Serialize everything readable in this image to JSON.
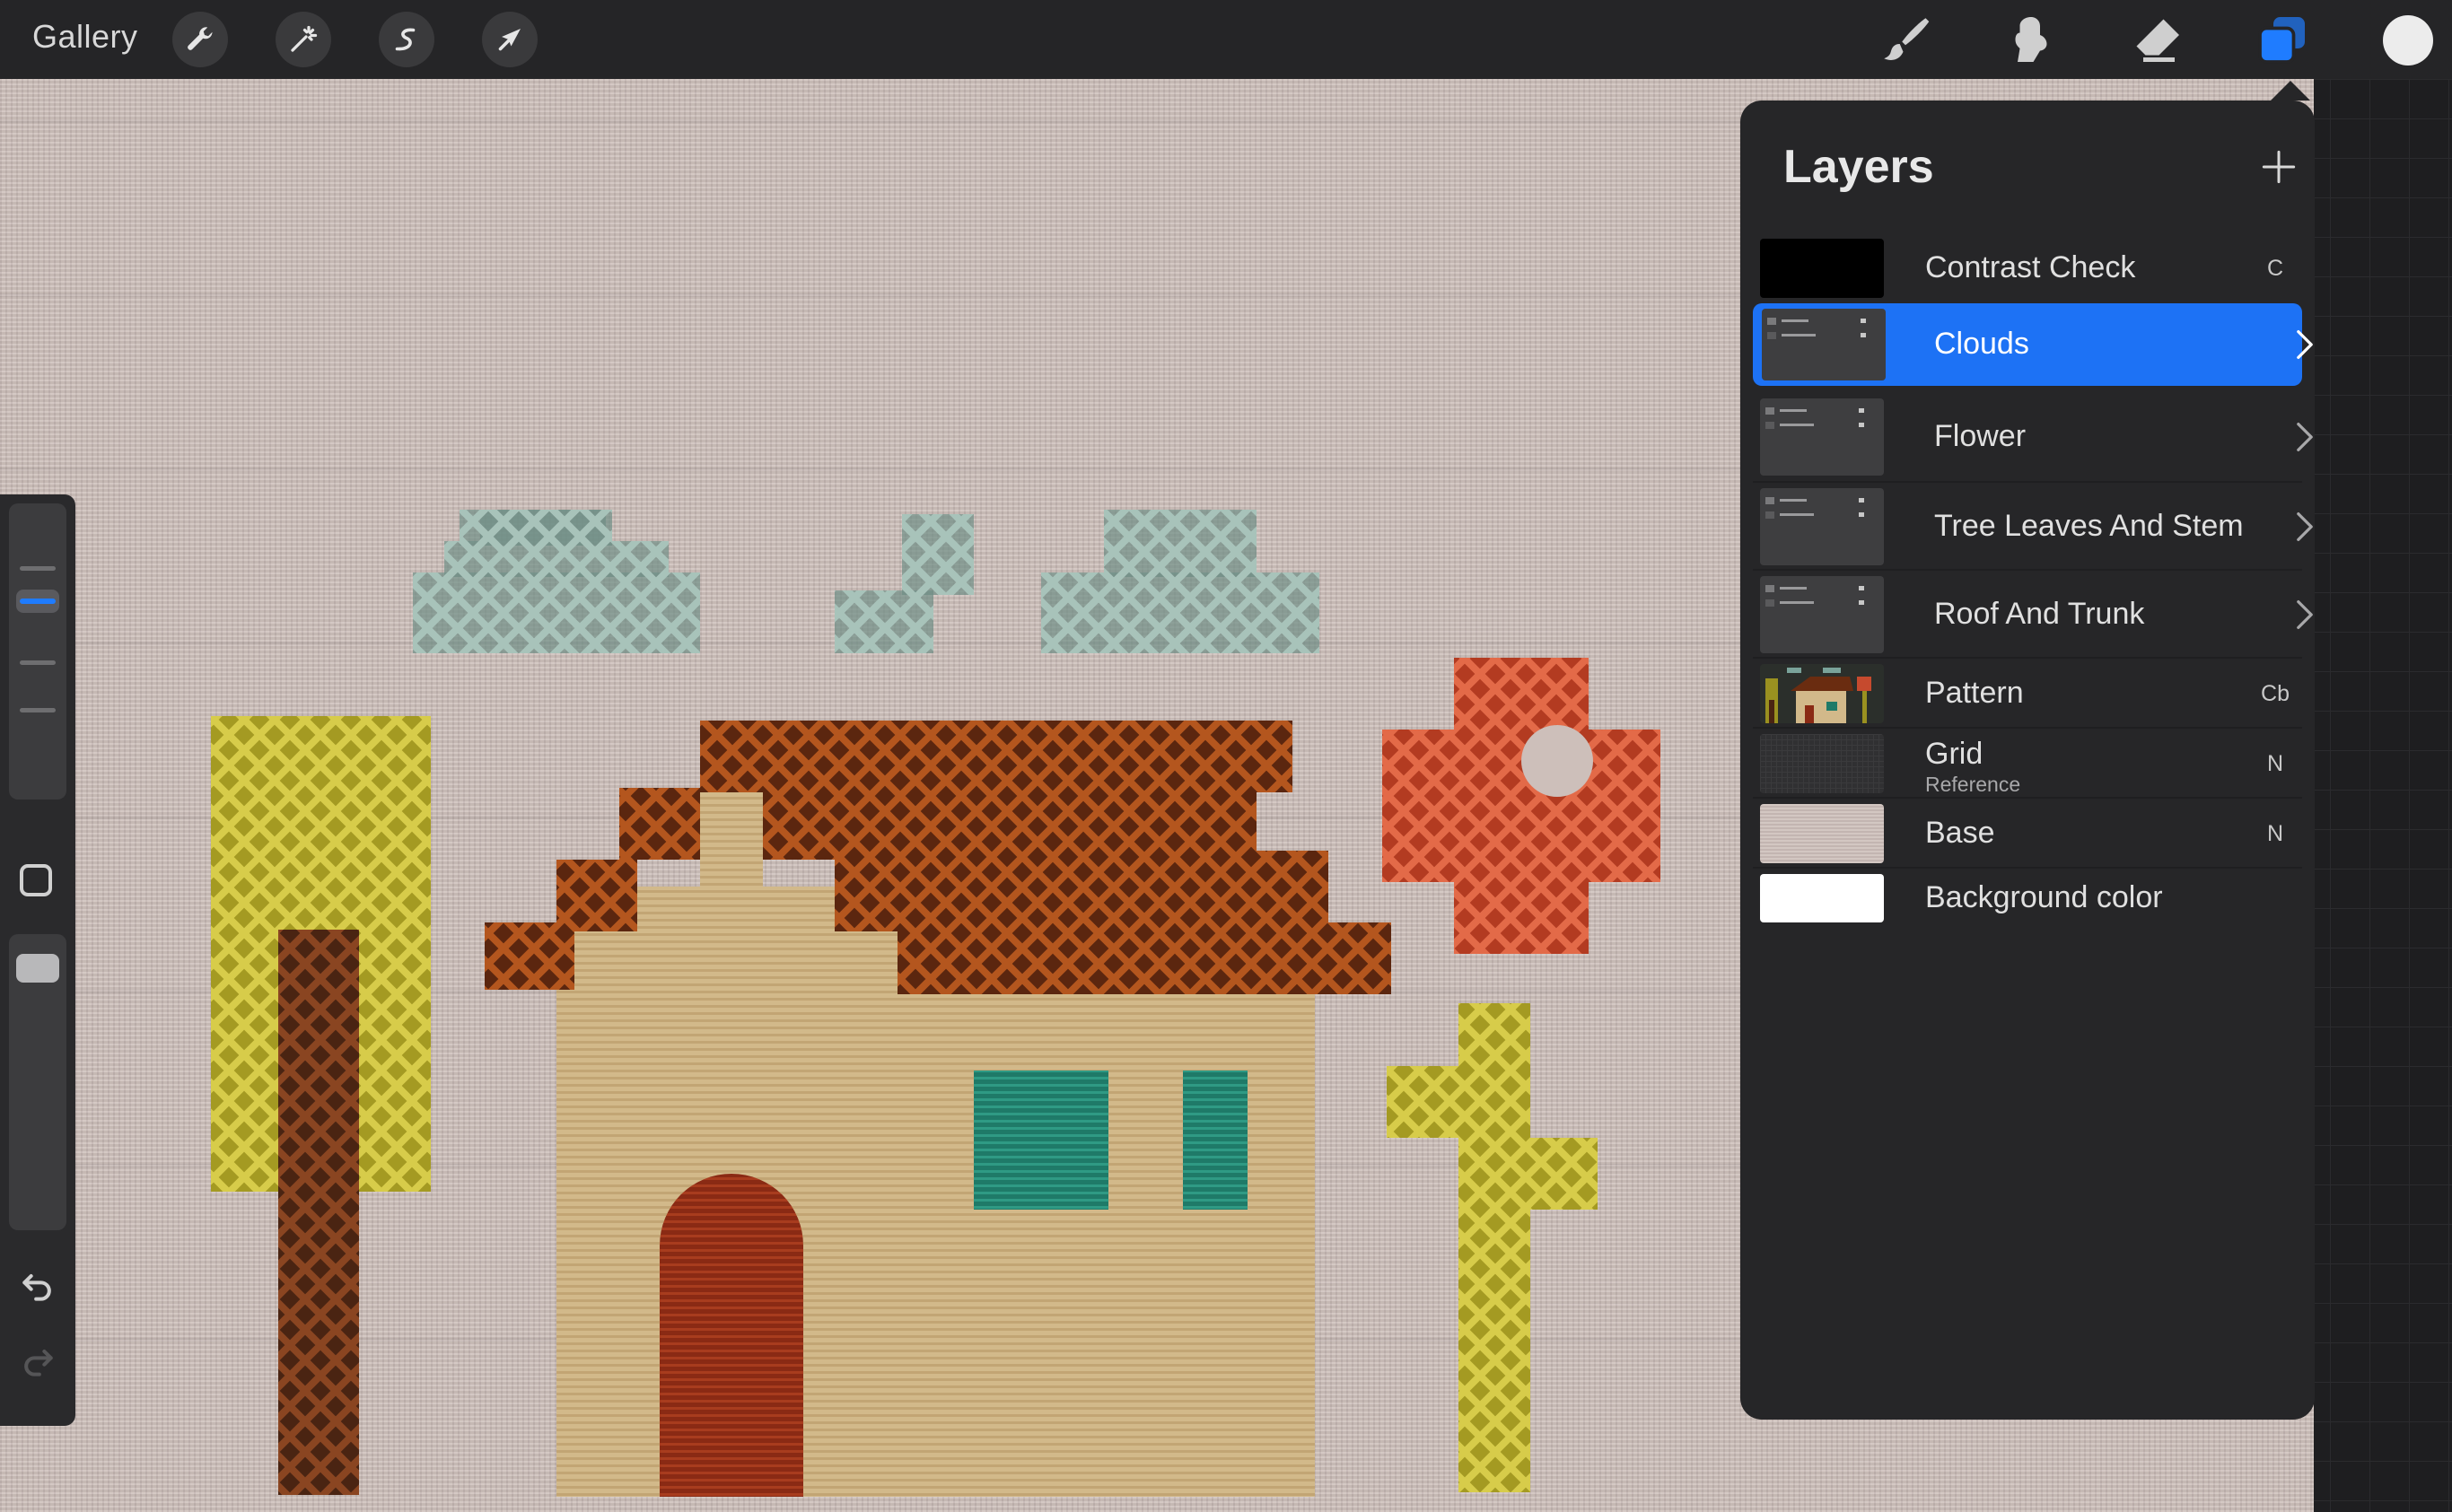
{
  "topbar": {
    "gallery_label": "Gallery",
    "left_tools": [
      "wrench-icon",
      "magic-wand-icon",
      "selection-icon",
      "transform-arrow-icon"
    ],
    "right_tools": [
      "brush-icon",
      "smudge-icon",
      "eraser-icon",
      "layers-icon"
    ],
    "active_tool": "layers-icon",
    "current_color": "#ececec"
  },
  "colors": {
    "accent": "#1d72f5",
    "panel_bg": "#262628",
    "canvas_bg": "#cdbfba"
  },
  "layers_panel": {
    "title": "Layers",
    "layers": [
      {
        "name": "Contrast Check",
        "sublabel": "",
        "mode": "C",
        "visible": false,
        "group": false,
        "selected": false,
        "thumbnail": "black"
      },
      {
        "name": "Clouds",
        "sublabel": "",
        "mode": "",
        "visible": true,
        "group": true,
        "selected": true,
        "thumbnail": "group"
      },
      {
        "name": "Flower",
        "sublabel": "",
        "mode": "",
        "visible": true,
        "group": true,
        "selected": false,
        "thumbnail": "group"
      },
      {
        "name": "Tree Leaves And Stem",
        "sublabel": "",
        "mode": "",
        "visible": true,
        "group": true,
        "selected": false,
        "thumbnail": "group"
      },
      {
        "name": "Roof And Trunk",
        "sublabel": "",
        "mode": "",
        "visible": true,
        "group": true,
        "selected": false,
        "thumbnail": "group"
      },
      {
        "name": "Pattern",
        "sublabel": "",
        "mode": "Cb",
        "visible": true,
        "group": false,
        "selected": false,
        "thumbnail": "pattern"
      },
      {
        "name": "Grid",
        "sublabel": "Reference",
        "mode": "N",
        "visible": false,
        "group": false,
        "selected": false,
        "thumbnail": "grid"
      },
      {
        "name": "Base",
        "sublabel": "",
        "mode": "N",
        "visible": true,
        "group": false,
        "selected": false,
        "thumbnail": "fabric"
      },
      {
        "name": "Background color",
        "sublabel": "",
        "mode": "",
        "visible": true,
        "group": false,
        "selected": false,
        "thumbnail": "white"
      }
    ]
  }
}
